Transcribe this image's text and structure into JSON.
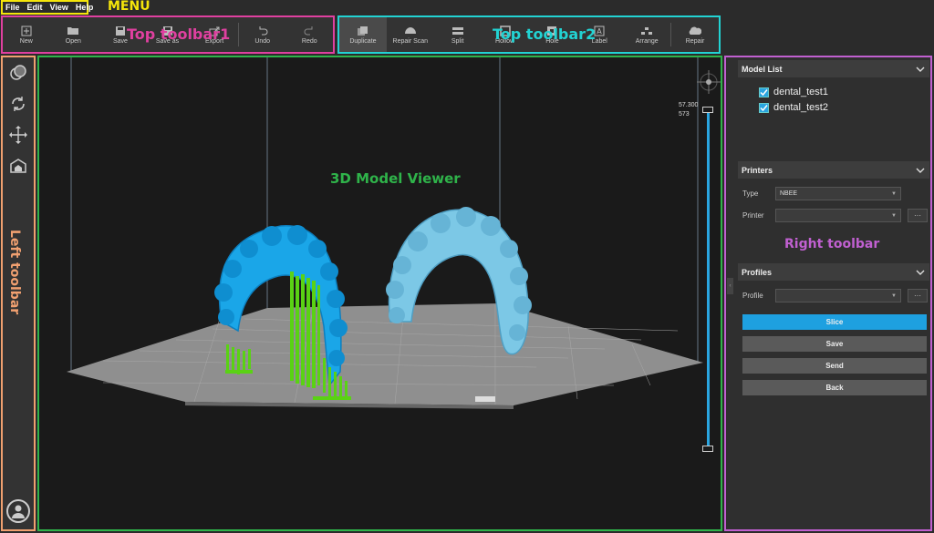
{
  "menu": {
    "items": [
      "File",
      "Edit",
      "View",
      "Help"
    ]
  },
  "annotations": {
    "menu": "MENU",
    "top_toolbar1": "Top toolbar1",
    "top_toolbar2": "Top toolbar2",
    "left_toolbar": "Left toolbar",
    "viewer": "3D Model Viewer",
    "right_toolbar": "Right toolbar"
  },
  "toolbar1": {
    "buttons": [
      {
        "label": "New",
        "icon": "new-file-icon"
      },
      {
        "label": "Open",
        "icon": "folder-open-icon"
      },
      {
        "label": "Save",
        "icon": "save-icon"
      },
      {
        "label": "Save as",
        "icon": "save-as-icon"
      },
      {
        "label": "Export",
        "icon": "export-icon"
      },
      {
        "label": "Undo",
        "icon": "undo-icon"
      },
      {
        "label": "Redo",
        "icon": "redo-icon"
      }
    ]
  },
  "toolbar2": {
    "buttons": [
      {
        "label": "Duplicate",
        "icon": "duplicate-icon",
        "active": true
      },
      {
        "label": "Repair Scan",
        "icon": "repair-scan-icon"
      },
      {
        "label": "Split",
        "icon": "split-icon"
      },
      {
        "label": "Hollow",
        "icon": "hollow-icon"
      },
      {
        "label": "Hole",
        "icon": "hole-icon"
      },
      {
        "label": "Label",
        "icon": "label-icon"
      },
      {
        "label": "Arrange",
        "icon": "arrange-icon"
      },
      {
        "label": "Repair",
        "icon": "repair-icon"
      }
    ]
  },
  "left_toolbar": {
    "tools": [
      "view-cube-icon",
      "rotate-icon",
      "move-icon",
      "scale-icon"
    ],
    "avatar": "user-avatar-icon"
  },
  "viewer": {
    "z_top_value": "57.300",
    "z_top_layer": "573",
    "model_colors": {
      "model1": "#1aa6e8",
      "model2": "#7cc8e6",
      "supports": "#5ad214",
      "plate": "#8a8a8a"
    }
  },
  "right_panel": {
    "model_list": {
      "title": "Model List",
      "items": [
        {
          "name": "dental_test1",
          "checked": true
        },
        {
          "name": "dental_test2",
          "checked": true
        }
      ]
    },
    "printers": {
      "title": "Printers",
      "type_label": "Type",
      "type_value": "NBEE",
      "printer_label": "Printer",
      "printer_value": "",
      "more": "···"
    },
    "profiles": {
      "title": "Profiles",
      "profile_label": "Profile",
      "profile_value": "",
      "more": "···"
    },
    "actions": {
      "slice": "Slice",
      "save": "Save",
      "send": "Send",
      "back": "Back"
    }
  },
  "colors": {
    "accent": "#1ea0e0",
    "menu_box": "#f5e50a",
    "tb1_box": "#e040a0",
    "tb2_box": "#22d3d3",
    "left_box": "#f0a070",
    "viewer_box": "#2fb34a",
    "right_box": "#c060d0"
  }
}
